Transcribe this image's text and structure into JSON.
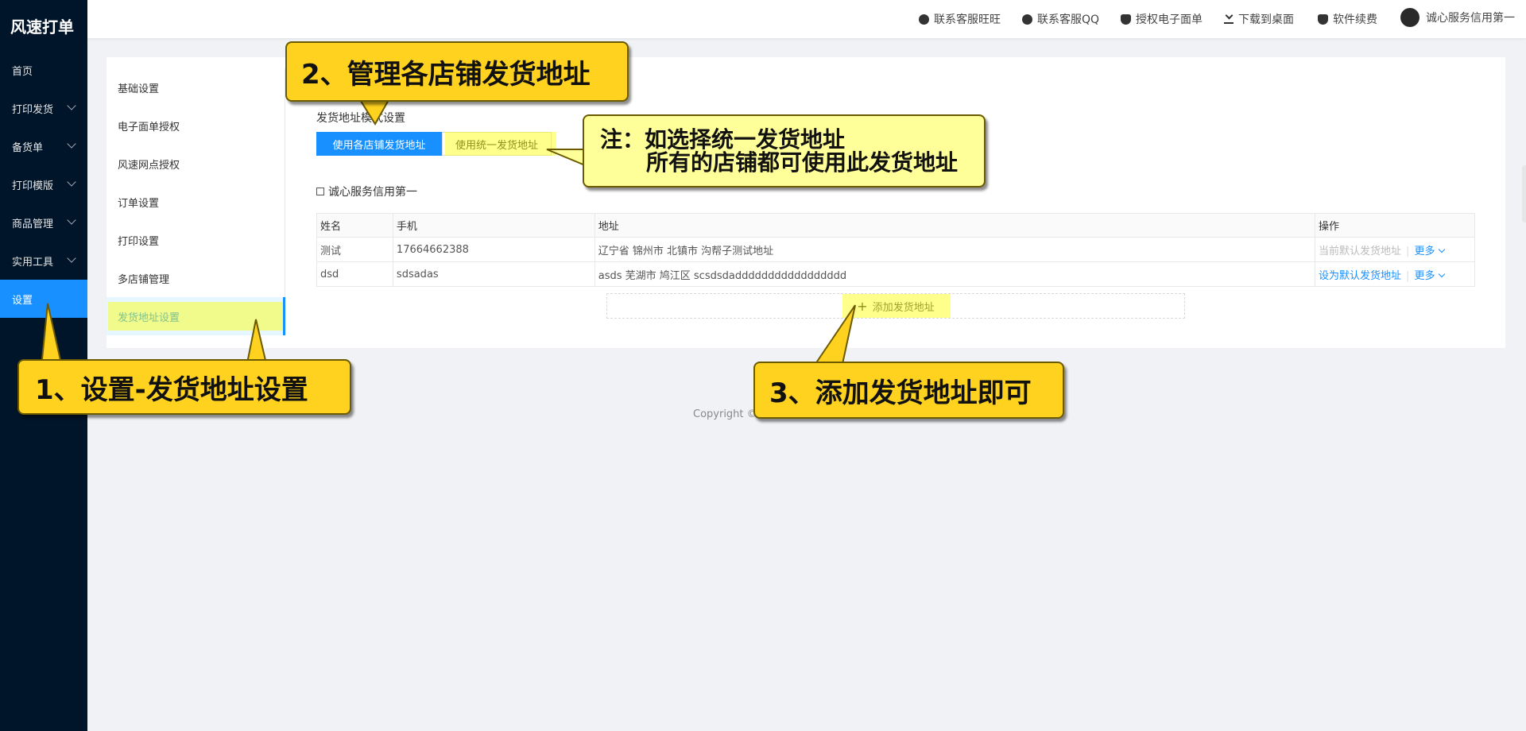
{
  "app": {
    "title": "风速打单"
  },
  "sidebar": {
    "items": [
      {
        "label": "首页",
        "expandable": false
      },
      {
        "label": "打印发货",
        "expandable": true
      },
      {
        "label": "备货单",
        "expandable": true
      },
      {
        "label": "打印模版",
        "expandable": true
      },
      {
        "label": "商品管理",
        "expandable": true
      },
      {
        "label": "实用工具",
        "expandable": true
      },
      {
        "label": "设置",
        "expandable": false,
        "active": true
      }
    ]
  },
  "header": {
    "links": [
      {
        "label": "联系客服旺旺",
        "icon": "wangwang-icon"
      },
      {
        "label": "联系客服QQ",
        "icon": "qq-icon"
      },
      {
        "label": "授权电子面单",
        "icon": "shield-check-icon"
      },
      {
        "label": "下载到桌面",
        "icon": "download-icon"
      },
      {
        "label": "软件续费",
        "icon": "shield-icon"
      }
    ],
    "user": "诚心服务信用第一"
  },
  "settings_nav": {
    "items": [
      "基础设置",
      "电子面单授权",
      "风速网点授权",
      "订单设置",
      "打印设置",
      "多店铺管理",
      "发货地址设置"
    ],
    "active": "发货地址设置"
  },
  "shipping": {
    "mode_title": "发货地址模式设置",
    "mode_options": [
      "使用各店铺发货地址",
      "使用统一发货地址"
    ],
    "selected_mode": "使用各店铺发货地址",
    "shop_name": "诚心服务信用第一",
    "table": {
      "headers": [
        "姓名",
        "手机",
        "地址",
        "操作"
      ],
      "rows": [
        {
          "name": "测试",
          "phone": "17664662388",
          "address": "辽宁省 锦州市 北镇市 沟帮子测试地址",
          "action": "当前默认发货地址",
          "action_enabled": false,
          "more": "更多"
        },
        {
          "name": "dsd",
          "phone": "sdsadas",
          "address": "asds 芜湖市 鸠江区 scsdsdaddddddddddddddddd",
          "action": "设为默认发货地址",
          "action_enabled": true,
          "more": "更多"
        }
      ]
    },
    "add_label": "添加发货地址"
  },
  "footer": {
    "copyright": "Copyright ©"
  },
  "annotations": {
    "step1": "1、设置-发货地址设置",
    "step2": "2、管理各店铺发货地址",
    "note_line1": "注：如选择统一发货地址",
    "note_line2": "所有的店铺都可使用此发货地址",
    "step3": "3、添加发货地址即可"
  },
  "colors": {
    "sidebar_bg": "#001529",
    "primary": "#1890ff",
    "callout": "#ffd21f",
    "note": "#ffff99"
  }
}
